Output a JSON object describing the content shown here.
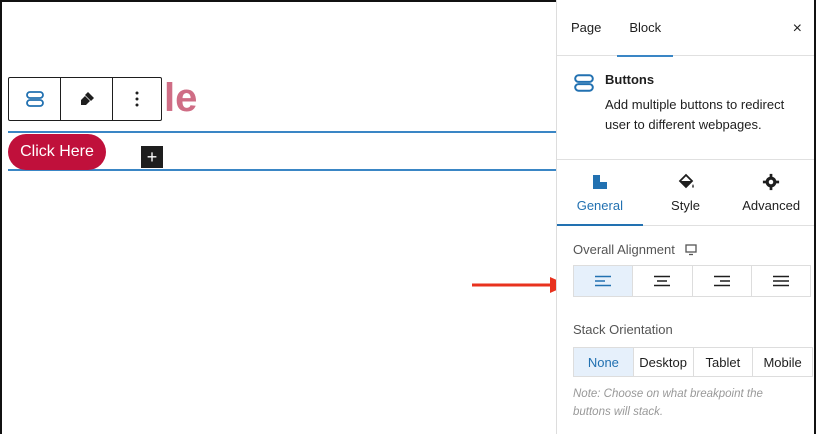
{
  "canvas": {
    "title_fragment": "le",
    "button_label": "Click Here",
    "add_symbol": "+",
    "toolbar": {
      "block_icon": "buttons-block-icon",
      "style_icon": "paint-brush-icon",
      "more_icon": "more-vertical-icon"
    }
  },
  "sidebar": {
    "tabs": [
      "Page",
      "Block"
    ],
    "active_tab": "Block",
    "close_symbol": "×",
    "block": {
      "name": "Buttons",
      "description": "Add multiple buttons to redirect user to different webpages."
    },
    "panel_tabs": [
      {
        "label": "General",
        "icon": "layout-icon"
      },
      {
        "label": "Style",
        "icon": "paint-bucket-icon"
      },
      {
        "label": "Advanced",
        "icon": "gear-icon"
      }
    ],
    "alignment": {
      "label": "Overall Alignment",
      "options": [
        "left",
        "center",
        "right",
        "justify"
      ],
      "selected": "left"
    },
    "stack": {
      "label": "Stack Orientation",
      "options": [
        "None",
        "Desktop",
        "Tablet",
        "Mobile"
      ],
      "selected": "None",
      "note": "Note: Choose on what breakpoint the buttons will stack."
    }
  },
  "colors": {
    "accent": "#2271b1",
    "button_bg": "#c0103b",
    "arrow": "#e8321e"
  }
}
